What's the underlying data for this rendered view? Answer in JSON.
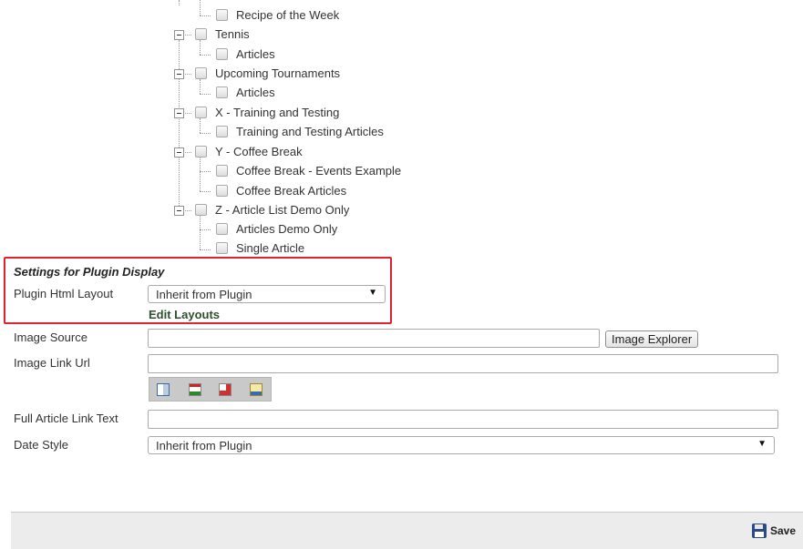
{
  "tree": {
    "items": [
      {
        "label": "Recipe of the Week",
        "level": 2
      },
      {
        "label": "Tennis",
        "level": 1,
        "expanded": true
      },
      {
        "label": "Articles",
        "level": 2
      },
      {
        "label": "Upcoming Tournaments",
        "level": 1,
        "expanded": true
      },
      {
        "label": "Articles",
        "level": 2
      },
      {
        "label": "X - Training and Testing",
        "level": 1,
        "expanded": true
      },
      {
        "label": "Training and Testing Articles",
        "level": 2
      },
      {
        "label": "Y - Coffee Break",
        "level": 1,
        "expanded": true
      },
      {
        "label": "Coffee Break - Events Example",
        "level": 2
      },
      {
        "label": "Coffee Break Articles",
        "level": 2
      },
      {
        "label": "Z - Article List Demo Only",
        "level": 1,
        "expanded": true
      },
      {
        "label": "Articles Demo Only",
        "level": 2
      },
      {
        "label": "Single Article",
        "level": 2
      }
    ]
  },
  "settings": {
    "title": "Settings for Plugin Display",
    "plugin_html_layout_label": "Plugin Html Layout",
    "plugin_html_layout_value": "Inherit from Plugin",
    "edit_layouts_label": "Edit Layouts"
  },
  "form": {
    "image_source_label": "Image Source",
    "image_source_value": "",
    "image_explorer_label": "Image Explorer",
    "image_link_url_label": "Image Link Url",
    "image_link_url_value": "",
    "link_tools": [
      "table-link-icon",
      "page-link-icon",
      "file-link-icon",
      "url-link-icon"
    ],
    "full_article_link_text_label": "Full Article Link Text",
    "full_article_link_text_value": "",
    "date_style_label": "Date Style",
    "date_style_value": "Inherit from Plugin"
  },
  "footer": {
    "save_label": "Save"
  },
  "colors": {
    "highlight_border": "#e0242f",
    "link_dark_green": "#2f4f2f",
    "footer_bg": "#ececec"
  }
}
